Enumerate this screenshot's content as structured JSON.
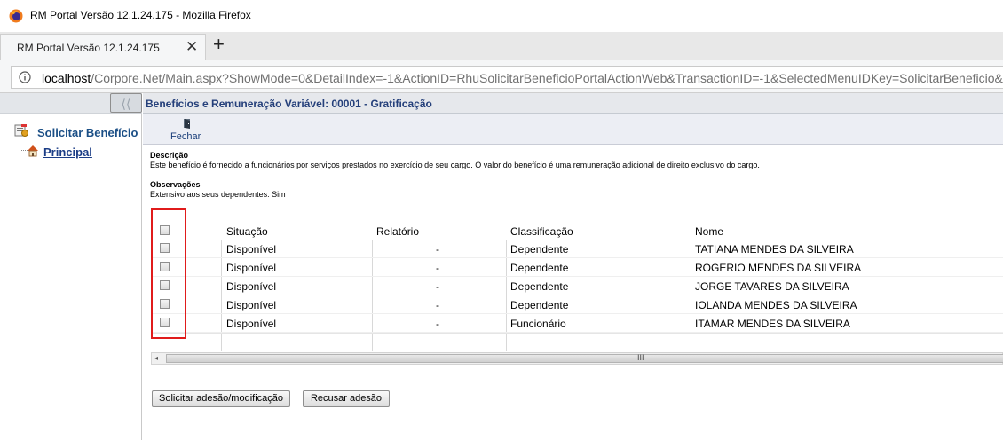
{
  "window": {
    "title": "RM Portal Versão 12.1.24.175 - Mozilla Firefox"
  },
  "tab": {
    "label": "RM Portal Versão 12.1.24.175",
    "close_glyph": "✕",
    "new_tab_glyph": "+"
  },
  "url": {
    "host": "localhost",
    "path": "/Corpore.Net/Main.aspx?ShowMode=0&DetailIndex=-1&ActionID=RhuSolicitarBeneficioPortalActionWeb&TransactionID=-1&SelectedMenuIDKey=SolicitarBeneficio&Ke"
  },
  "sidebar": {
    "collapse_glyph": "⟨⟨",
    "root_label": "Solicitar Benefício",
    "child_label": "Principal"
  },
  "main": {
    "header": "Benefícios e Remuneração Variável: 00001 - Gratificação",
    "toolbar": {
      "close_label": "Fechar"
    },
    "description_label": "Descrição",
    "description_text": "Este benefício é fornecido a funcionários por serviços prestados no exercício de seu cargo. O valor do benefício é uma remuneração adicional de direito exclusivo do cargo.",
    "observations_label": "Observações",
    "observations_text": "Extensivo aos seus dependentes: Sim"
  },
  "grid": {
    "columns": [
      "Situação",
      "Relatório",
      "Classificação",
      "Nome"
    ],
    "rows": [
      {
        "situacao": "Disponível",
        "relatorio": "-",
        "classificacao": "Dependente",
        "nome": "TATIANA MENDES DA SILVEIRA"
      },
      {
        "situacao": "Disponível",
        "relatorio": "-",
        "classificacao": "Dependente",
        "nome": "ROGERIO MENDES DA SILVEIRA"
      },
      {
        "situacao": "Disponível",
        "relatorio": "-",
        "classificacao": "Dependente",
        "nome": "JORGE TAVARES DA SILVEIRA"
      },
      {
        "situacao": "Disponível",
        "relatorio": "-",
        "classificacao": "Dependente",
        "nome": "IOLANDA MENDES DA SILVEIRA"
      },
      {
        "situacao": "Disponível",
        "relatorio": "-",
        "classificacao": "Funcionário",
        "nome": "ITAMAR MENDES DA SILVEIRA"
      }
    ],
    "scroll_left_glyph": "◂",
    "scroll_grip": "III"
  },
  "buttons": {
    "request": "Solicitar adesão/modificação",
    "refuse": "Recusar adesão"
  },
  "colors": {
    "highlight": "#e01b1b",
    "link": "#1b4f86"
  },
  "icons": [
    "firefox-icon",
    "info-icon",
    "beneficio-icon",
    "home-icon",
    "close-door-icon"
  ]
}
